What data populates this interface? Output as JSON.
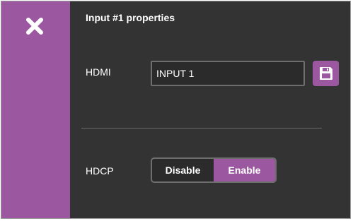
{
  "panel": {
    "title": "Input #1 properties"
  },
  "hdmi": {
    "label": "HDMI",
    "value": "INPUT 1"
  },
  "hdcp": {
    "label": "HDCP",
    "options": [
      "Disable",
      "Enable"
    ],
    "selected": "Enable"
  },
  "icons": {
    "close": "close-icon",
    "save": "floppy-disk-icon"
  },
  "colors": {
    "accent": "#9b58a0",
    "panel_background": "#333333",
    "text": "#ffffff"
  }
}
